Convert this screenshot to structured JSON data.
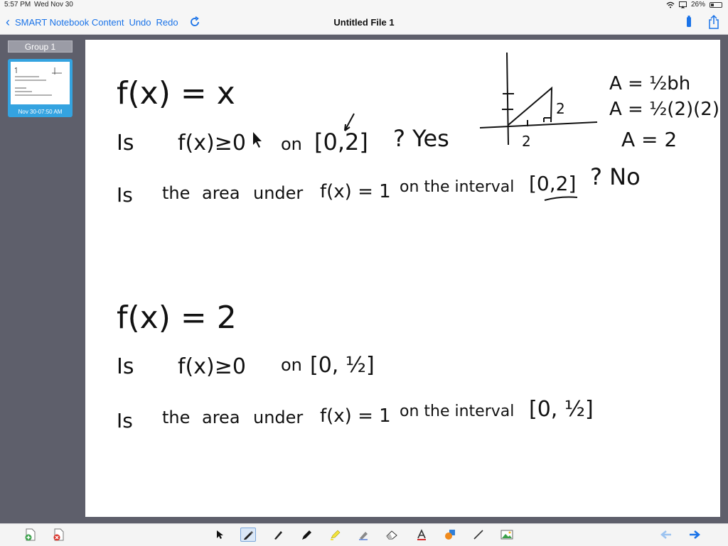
{
  "status": {
    "time": "5:57 PM",
    "date": "Wed Nov 30",
    "battery": "26%",
    "battery_level": 0.26
  },
  "nav": {
    "back_label": "SMART Notebook Content",
    "undo_label": "Undo",
    "redo_label": "Redo",
    "title": "Untitled File 1"
  },
  "sidebar": {
    "group_label": "Group 1",
    "thumbnail_caption": "Nov 30-07:50 AM"
  },
  "colors": {
    "accent": "#1a73e8",
    "thumbnail_border": "#34a3e0",
    "ink": "#111111"
  },
  "handwriting": {
    "line1": "f(x) = x",
    "line2_q": "Is",
    "line2_expr": "f(x)≥0",
    "line2_on": "on",
    "line2_interval": "[0,2]",
    "line2_answer": "? Yes",
    "line3_q": "Is",
    "line3_the": "the",
    "line3_area": "area",
    "line3_under": "under",
    "line3_expr": "f(x) = 1",
    "line3_rest": "on the interval",
    "line3_interval": "[0,2]",
    "line3_answer": "? No",
    "area_formula1": "A = ½bh",
    "area_formula2": "A = ½(2)(2)",
    "area_formula3": "A = 2",
    "graph_label_base": "2",
    "graph_label_height": "2",
    "line4": "f(x) = 2",
    "line5_q": "Is",
    "line5_expr": "f(x)≥0",
    "line5_on": "on",
    "line5_interval": "[0, ½]",
    "line6_q": "Is",
    "line6_the": "the",
    "line6_area": "area",
    "line6_under": "under",
    "line6_expr": "f(x) = 1",
    "line6_rest": "on the interval",
    "line6_interval": "[0, ½]"
  },
  "toolbar": {
    "tools": [
      "select-icon",
      "pen-icon",
      "calligraphy-pen-icon",
      "marker-icon",
      "highlighter-icon",
      "magic-pen-icon",
      "eraser-icon",
      "text-icon",
      "shapes-icon",
      "line-icon",
      "image-icon"
    ],
    "active_tool": "pen-icon"
  }
}
